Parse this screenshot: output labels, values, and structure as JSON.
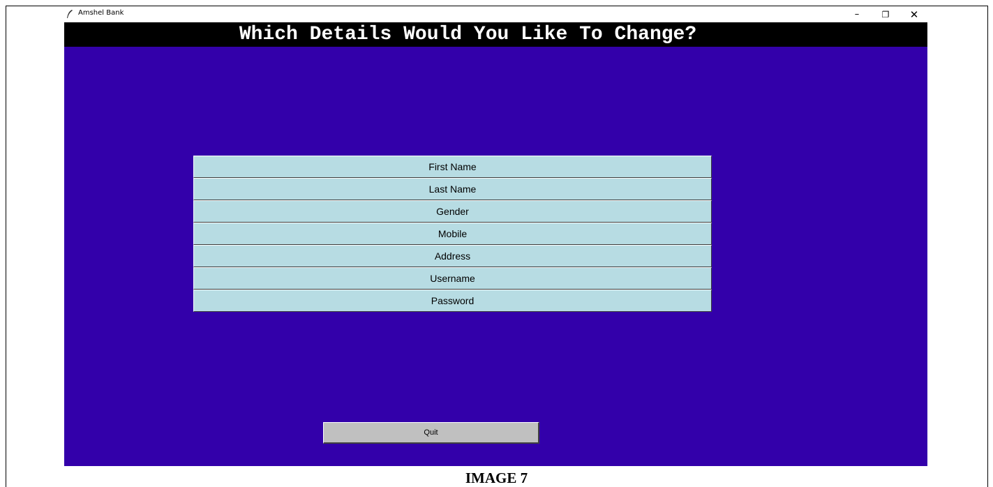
{
  "window": {
    "title": "Amshel Bank",
    "icon": "feather-icon",
    "controls": {
      "minimize": "–",
      "maximize": "❐",
      "close": "✕"
    }
  },
  "heading": "Which Details Would You Like To Change?",
  "options": [
    {
      "label": "First Name"
    },
    {
      "label": "Last Name"
    },
    {
      "label": "Gender"
    },
    {
      "label": "Mobile"
    },
    {
      "label": "Address"
    },
    {
      "label": "Username"
    },
    {
      "label": "Password"
    }
  ],
  "quit_label": "Quit",
  "caption": "IMAGE 7",
  "colors": {
    "background": "#3300aa",
    "heading_bar": "#000000",
    "option_button": "#b7dce3",
    "quit_button": "#c0c0c0"
  }
}
